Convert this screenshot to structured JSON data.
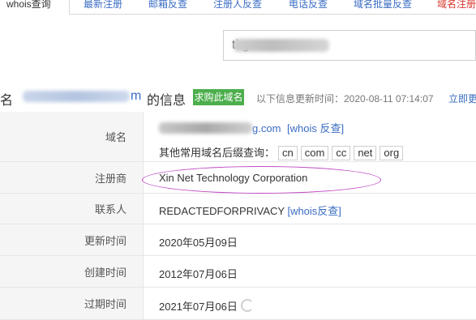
{
  "tabs": [
    {
      "label": "whois查询",
      "active": true
    },
    {
      "label": "最新注册"
    },
    {
      "label": "邮箱反查"
    },
    {
      "label": "注册人反查"
    },
    {
      "label": "电话反查"
    },
    {
      "label": "域名批量反查"
    },
    {
      "label": "域名注册",
      "color": "#d9362c"
    }
  ],
  "search": {
    "value": "ti g.com"
  },
  "info": {
    "prefix": "名",
    "domain_end": "m",
    "suffix": "的信息",
    "buy_label": "求购此域名",
    "update_text": "以下信息更新时间：2020-08-11 07:14:07",
    "update_link": "立即更新"
  },
  "rows": {
    "domain": {
      "key": "域名",
      "value_end": "g.com",
      "whois_link": "[whois 反查]",
      "suffix_label": "其他常用域名后缀查询：",
      "suffixes": [
        "cn",
        "com",
        "cc",
        "net",
        "org"
      ]
    },
    "registrar": {
      "key": "注册商",
      "value": "Xin Net Technology Corporation"
    },
    "contact": {
      "key": "联系人",
      "value": "REDACTEDFORPRIVACY",
      "link": "[whois反查]"
    },
    "updated": {
      "key": "更新时间",
      "value": "2020年05月09日"
    },
    "created": {
      "key": "创建时间",
      "value": "2012年07月06日"
    },
    "expires": {
      "key": "过期时间",
      "value": "2021年07月06日"
    }
  },
  "colors": {
    "link": "#3a6cc3",
    "buy_button": "#4cae4c",
    "highlight": "#c048c4"
  }
}
